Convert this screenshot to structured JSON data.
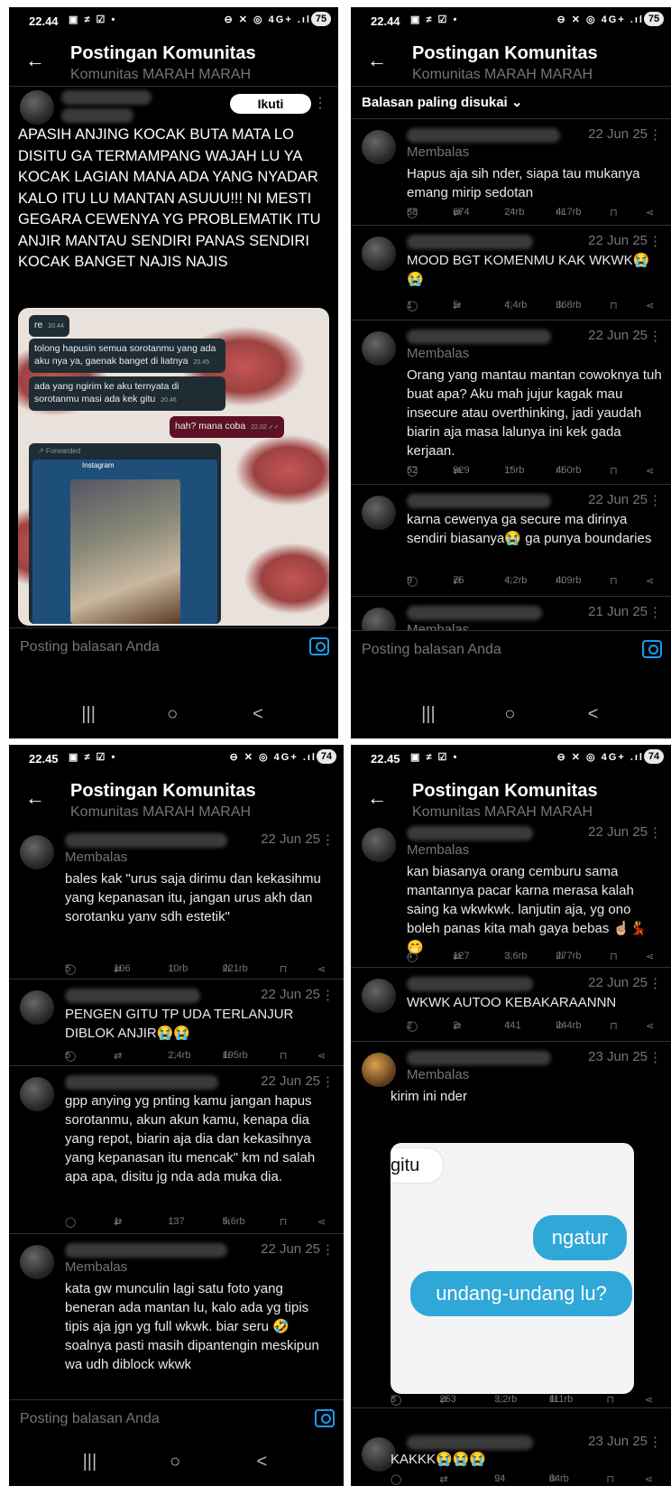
{
  "common": {
    "title": "Postingan Komunitas",
    "subtitle": "Komunitas MARAH MARAH",
    "reply_placeholder": "Posting balasan Anda",
    "membalas": "Membalas",
    "back": "←",
    "nav_recents": "|||",
    "nav_home": "○",
    "nav_back": "<",
    "more": "⋮"
  },
  "screens": [
    {
      "time": "22.44",
      "status_left": "▣ ≠ ☑ •",
      "status_right": "⊖ ✕ ◎ 4G+ .ıl",
      "battery": "75",
      "follow_label": "Ikuti",
      "op_text": "APASIH ANJING KOCAK BUTA MATA LO DISITU GA TERMAMPANG WAJAH LU YA KOCAK LAGIAN MANA ADA YANG NYADAR KALO ITU LU MANTAN ASUUU!!! NI MESTI GEGARA CEWENYA YG PROBLEMATIK ITU ANJIR MANTAU SENDIRI PANAS SENDIRI KOCAK BANGET NAJIS NAJIS",
      "chat": [
        {
          "text": "re",
          "time": "20.44"
        },
        {
          "text": "tolong hapusin semua sorotanmu yang ada aku nya ya, gaenak banget di liatnya",
          "time": "20.45"
        },
        {
          "text": "ada yang ngirim ke aku ternyata di sorotanmu masi ada kek gitu",
          "time": "20.46"
        },
        {
          "text": "hah? mana coba",
          "time": "22.02 ✓✓"
        }
      ],
      "forwarded": "↗ Forwarded",
      "instagram": "Instagram"
    },
    {
      "time": "22.44",
      "status_left": "▣ ≠ ☑ •",
      "status_right": "⊖ ✕ ◎ 4G+ .ıl",
      "battery": "75",
      "sort_label": "Balasan paling disukai ⌄",
      "tweets": [
        {
          "date": "22 Jun 25",
          "membalas": true,
          "text": "Hapus aja sih nder, siapa tau mukanya emang mirip sedotan",
          "replies": "88",
          "reposts": "874",
          "likes": "24rb",
          "views": "417rb"
        },
        {
          "date": "22 Jun 25",
          "membalas": false,
          "text": "MOOD BGT KOMENMU KAK WKWK😭😭",
          "replies": "1",
          "reposts": "5",
          "likes": "4,4rb",
          "views": "368rb"
        },
        {
          "date": "22 Jun 25",
          "membalas": true,
          "text": "Orang yang mantau mantan cowoknya tuh buat apa? Aku mah jujur kagak mau insecure atau overthinking, jadi yaudah biarin aja masa lalunya ini kek gada kerjaan.",
          "replies": "52",
          "reposts": "929",
          "likes": "15rb",
          "views": "450rb"
        },
        {
          "date": "22 Jun 25",
          "membalas": false,
          "text": "karna cewenya ga secure ma dirinya sendiri biasanya😭 ga punya boundaries",
          "replies": "9",
          "reposts": "75",
          "likes": "4,2rb",
          "views": "409rb"
        },
        {
          "date": "21 Jun 25",
          "membalas": true,
          "text": "",
          "replies": "",
          "reposts": "",
          "likes": "",
          "views": ""
        }
      ]
    },
    {
      "time": "22.45",
      "status_left": "▣ ≠ ☑ •",
      "status_right": "⊖ ✕ ◎ 4G+ .ıl",
      "battery": "74",
      "tweets": [
        {
          "date": "22 Jun 25",
          "membalas": true,
          "text": "bales kak \"urus saja dirimu dan kekasihmu yang kepanasan itu, jangan urus akh dan sorotanku yanv sdh estetik\"",
          "replies": "5",
          "reposts": "106",
          "likes": "10rb",
          "views": "221rb"
        },
        {
          "date": "22 Jun 25",
          "membalas": false,
          "text": "PENGEN GITU TP UDA TERLANJUR DIBLOK ANJIR😭😭",
          "replies": "6",
          "reposts": "",
          "likes": "2,4rb",
          "views": "195rb"
        },
        {
          "date": "22 Jun 25",
          "membalas": false,
          "text": "gpp anying yg pnting kamu jangan hapus sorotanmu, akun akun kamu, kenapa dia yang repot, biarin aja dia dan kekasihnya yang kepanasan itu mencak\" km nd salah apa apa, disitu jg nda ada muka dia.",
          "replies": "",
          "reposts": "1",
          "likes": "137",
          "views": "5,6rb"
        },
        {
          "date": "22 Jun 25",
          "membalas": true,
          "text": "kata gw munculin lagi satu foto yang beneran ada mantan lu, kalo ada yg tipis tipis aja jgn yg full wkwk. biar seru 🤣 soalnya pasti masih dipantengin meskipun wa udh diblock wkwk",
          "replies": "",
          "reposts": "",
          "likes": "",
          "views": ""
        }
      ]
    },
    {
      "time": "22.45",
      "status_left": "▣ ≠ ☑ •",
      "status_right": "⊖ ✕ ◎ 4G+ .ıl",
      "battery": "74",
      "tweets": [
        {
          "date": "22 Jun 25",
          "membalas": true,
          "text": "kan biasanya orang cemburu sama mantannya pacar karna merasa kalah saing ka wkwkwk. lanjutin aja, yg ono boleh panas kita mah gaya bebas ☝🏼💃 🤭",
          "replies": "4",
          "reposts": "127",
          "likes": "3,6rb",
          "views": "277rb"
        },
        {
          "date": "22 Jun 25",
          "membalas": false,
          "text": "WKWK AUTOO KEBAKARAANNN",
          "replies": "2",
          "reposts": "2",
          "likes": "441",
          "views": "244rb"
        },
        {
          "date": "23 Jun 25",
          "membalas": true,
          "text": "kirim ini nder",
          "replies": "8",
          "reposts": "253",
          "likes": "3,2rb",
          "views": "111rb"
        },
        {
          "date": "23 Jun 25",
          "membalas": false,
          "text": "KAKKK😭😭😭",
          "replies": "",
          "reposts": "",
          "likes": "94",
          "views": "84rb"
        }
      ],
      "image_text": {
        "top": "gitu",
        "bubble1": "ngatur",
        "bubble2": "undang-undang lu?"
      }
    }
  ],
  "icons": {
    "reply": "◯",
    "repost": "⇄",
    "like": "♡",
    "views": "ılı",
    "bookmark": "⊓",
    "share": "⋖"
  }
}
